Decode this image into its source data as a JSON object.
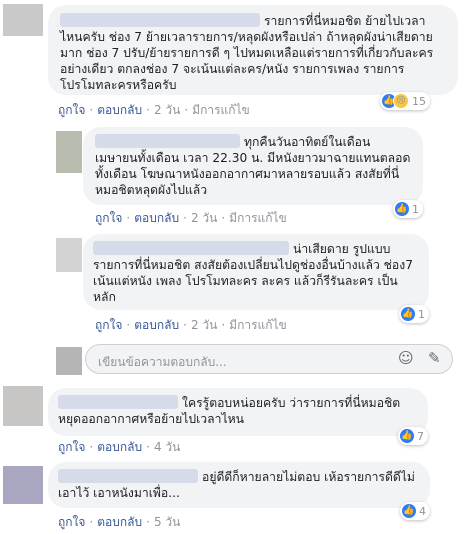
{
  "comments": [
    {
      "text": "รายการที่นี่หมอชิต ย้ายไปเวลาไหนครับ ช่อง 7 ย้ายเวลารายการ/หลุดผังหรือเปล่า ถ้าหลุดผังน่าเสียดายมาก ช่อง 7 ปรับ/ย้ายรายการดี ๆ ไปหมดเหลือแต่รายการที่เกี่ยวกับละครอย่างเดียว ตกลงช่อง 7 จะเน้นแต่ละคร/หนัง รายการเพลง รายการโปรโมทละครหรือครับ",
      "like": "ถูกใจ",
      "reply": "ตอบกลับ",
      "time": "2 วัน",
      "edited": "มีการแก้ไข",
      "reaction_count": "15"
    },
    {
      "text": "ทุกคืนวันอาทิตย์ในเดือนเมษายนทั้งเดือน เวลา 22.30 น. มีหนังยาวมาฉายแทนตลอดทั้งเดือน โฆษณาหนังออกอากาศมาหลายรอบแล้ว สงสัยที่นี่หมอชิตหลุดผังไปแล้ว",
      "like": "ถูกใจ",
      "reply": "ตอบกลับ",
      "time": "2 วัน",
      "edited": "มีการแก้ไข",
      "reaction_count": "1"
    },
    {
      "text": "น่าเสียดาย รูปแบบรายการที่นี่หมอชิต สงสัยต้องเปลี่ยนไปดูช่องอื่นบ้างแล้ว ช่อง7 เน้นแต่หนัง เพลง โปรโมทละคร ละคร แล้วก็รีรันละคร เป็นหลัก",
      "like": "ถูกใจ",
      "reply": "ตอบกลับ",
      "time": "2 วัน",
      "edited": "มีการแก้ไข",
      "reaction_count": "1"
    },
    {
      "text": "ใครรู้ตอบหน่อยครับ ว่ารายการที่นี่หมอชิตหยุดออกอากาศหรือย้ายไปเวลาไหน",
      "like": "ถูกใจ",
      "reply": "ตอบกลับ",
      "time": "4 วัน",
      "reaction_count": "7"
    },
    {
      "text": "อยู่ดีดีก็หายลายไม่ตอบ เห้อรายการดีดีไม่เอาไว้ เอาหนังมาเพื่อ...",
      "like": "ถูกใจ",
      "reply": "ตอบกลับ",
      "time": "5 วัน",
      "reaction_count": "4"
    }
  ],
  "reply_box": {
    "placeholder": "เขียนข้อความตอบกลับ..."
  },
  "icons": {
    "like": "thumbs-up-icon",
    "sad": "sad-face-icon",
    "emoji": "smiley-icon",
    "sticker": "sticker-icon"
  },
  "colors": {
    "link": "#385898",
    "muted": "#90949c",
    "bubble": "#f2f3f5",
    "like_blue": "#2f7cf6"
  }
}
